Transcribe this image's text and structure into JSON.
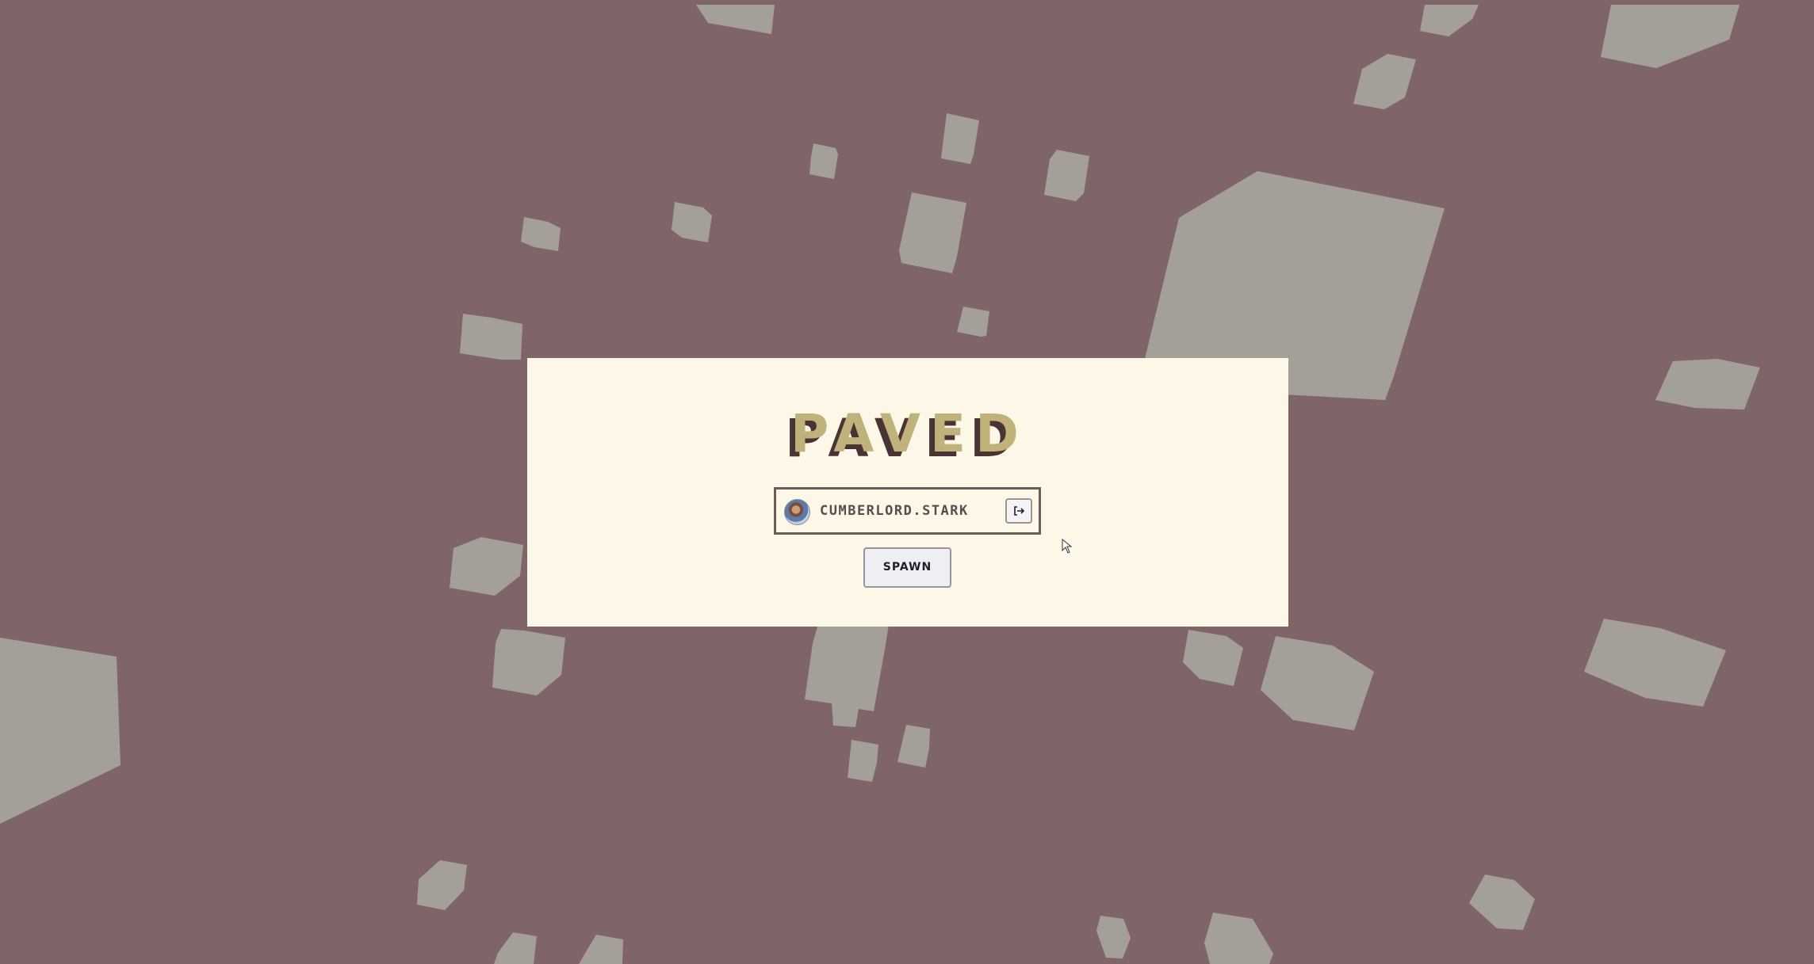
{
  "game": {
    "logo_text": "PAVED",
    "logo_colors": {
      "face": "#bfb27a",
      "shadow": "#4a3334"
    },
    "account": {
      "avatar": "avatar-image",
      "username": "CUMBERLORD.STARK",
      "logout_icon": "logout-icon"
    },
    "spawn_label": "SPAWN"
  },
  "colors": {
    "background": "#7f6569",
    "rocks": "#a4a098",
    "panel": "#fdf7e8",
    "panel_border": "#6f5a5b"
  }
}
